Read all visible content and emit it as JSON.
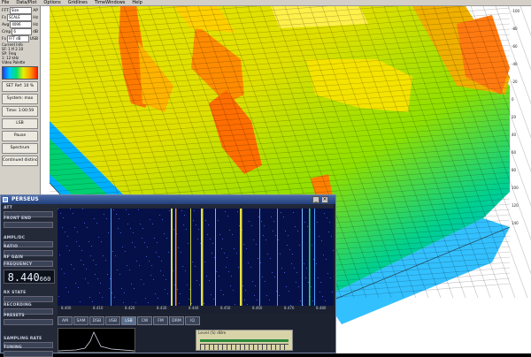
{
  "menu": [
    "File",
    "Data/Plot",
    "Options",
    "Gridlines",
    "TimeWindows",
    "Help"
  ],
  "left_panel": {
    "rows": [
      {
        "label": "FFT",
        "value": "Size",
        "extra": "AP"
      },
      {
        "label": "Fs",
        "value": "SCALE",
        "extra": "Hz"
      },
      {
        "label": "Avg",
        "value": "4096",
        "extra": "Hz"
      },
      {
        "label": "Cmp",
        "value": "6",
        "extra": "dB"
      },
      {
        "label": "Fs",
        "value": "FFT dB",
        "extra": "USB"
      }
    ],
    "info_title": "Current Info",
    "info_lines": [
      "SF: 1 tf 2.10",
      "SP: Freq",
      "1: 12 kHz"
    ],
    "color_title": "Video Palette",
    "buttons": [
      "SET Ref: 10 %",
      "System: max",
      "Time: 1:00:59",
      "LSB",
      "Pause",
      "Spectrum",
      "Continued distinct"
    ]
  },
  "right_axis_ticks": [
    "-100",
    "-80",
    "-60",
    "-40",
    "-20",
    "0",
    "20",
    "40",
    "60",
    "80",
    "100",
    "120",
    "140"
  ],
  "perseus": {
    "title": "PERSEUS",
    "side_labels": [
      "ATT",
      "FRONT END",
      "AMPL/DC",
      "RATIO",
      "RF GAIN",
      "FREQUENCY",
      "RX STATE",
      "RECORDING",
      "PRESETS",
      "SAMPLING RATE",
      "TUNING"
    ],
    "frequency": "8.440",
    "frequency_small": "660",
    "step": "ST 1 KHz",
    "waterfall_ticks": [
      "8.400",
      "8.410",
      "8.420",
      "8.430",
      "8.440",
      "8.450",
      "8.460",
      "8.470",
      "8.480"
    ],
    "modes": [
      "AM",
      "SAM",
      "DSB",
      "USB",
      "LSB",
      "CW",
      "FM",
      "DRM",
      "IQ"
    ],
    "active_mode": "LSB",
    "smeter_label": "Level (S) dBm"
  },
  "colors": {
    "accent": "#22407a",
    "waterfall_bg": "#061048"
  }
}
